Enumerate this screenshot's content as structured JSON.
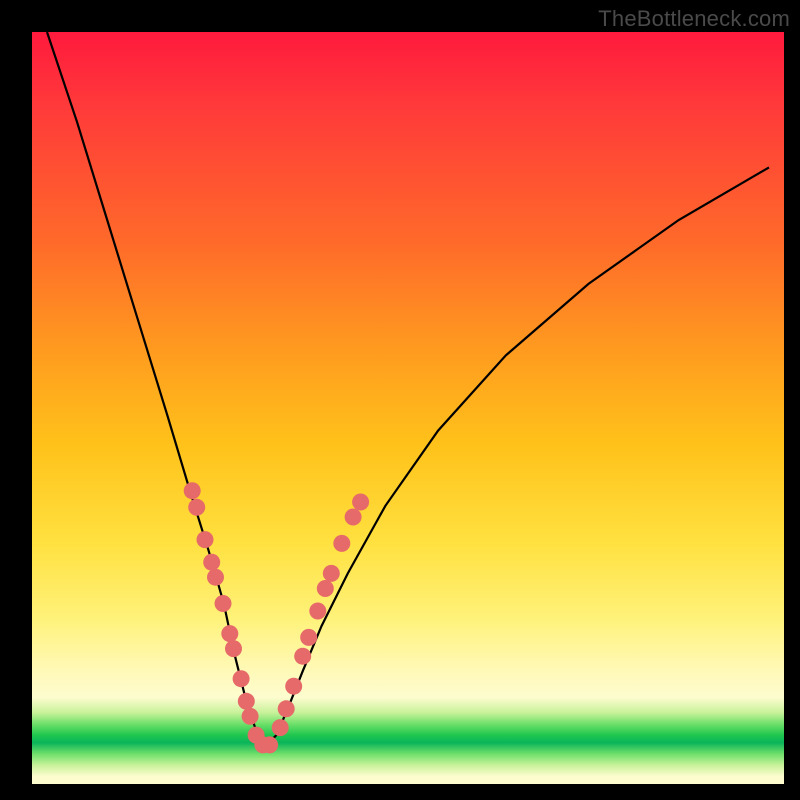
{
  "watermark": "TheBottleneck.com",
  "colors": {
    "dots": "#e76a6a",
    "curve": "#000000",
    "frame": "#000000"
  },
  "chart_data": {
    "type": "line",
    "title": "",
    "xlabel": "",
    "ylabel": "",
    "xlim": [
      0,
      100
    ],
    "ylim": [
      0,
      100
    ],
    "note": "Stylized bottleneck V-curve on a red→green vertical gradient. No numeric axes; values are pixel-relative percentages estimated from the image.",
    "series": [
      {
        "name": "curve",
        "x": [
          2,
          6,
          10,
          14,
          18,
          21,
          23.5,
          25.5,
          27,
          28.5,
          30,
          31,
          32.5,
          34,
          36,
          38.5,
          42,
          47,
          54,
          63,
          74,
          86,
          98
        ],
        "y": [
          0,
          12,
          25,
          38,
          51,
          61,
          69,
          76,
          83,
          89,
          93.5,
          95,
          93.5,
          90,
          85,
          79,
          72,
          63,
          53,
          43,
          33.5,
          25,
          18
        ]
      }
    ],
    "dots_left": [
      {
        "x": 21.3,
        "y": 61.0
      },
      {
        "x": 21.9,
        "y": 63.2
      },
      {
        "x": 23.0,
        "y": 67.5
      },
      {
        "x": 23.9,
        "y": 70.5
      },
      {
        "x": 24.4,
        "y": 72.5
      },
      {
        "x": 25.4,
        "y": 76.0
      },
      {
        "x": 26.3,
        "y": 80.0
      },
      {
        "x": 26.8,
        "y": 82.0
      },
      {
        "x": 27.8,
        "y": 86.0
      },
      {
        "x": 28.5,
        "y": 89.0
      },
      {
        "x": 29.0,
        "y": 91.0
      },
      {
        "x": 29.8,
        "y": 93.5
      },
      {
        "x": 30.7,
        "y": 94.8
      },
      {
        "x": 31.6,
        "y": 94.8
      }
    ],
    "dots_right": [
      {
        "x": 33.0,
        "y": 92.5
      },
      {
        "x": 33.8,
        "y": 90.0
      },
      {
        "x": 34.8,
        "y": 87.0
      },
      {
        "x": 36.0,
        "y": 83.0
      },
      {
        "x": 36.8,
        "y": 80.5
      },
      {
        "x": 38.0,
        "y": 77.0
      },
      {
        "x": 39.0,
        "y": 74.0
      },
      {
        "x": 39.8,
        "y": 72.0
      },
      {
        "x": 41.2,
        "y": 68.0
      },
      {
        "x": 42.7,
        "y": 64.5
      },
      {
        "x": 43.7,
        "y": 62.5
      }
    ]
  }
}
